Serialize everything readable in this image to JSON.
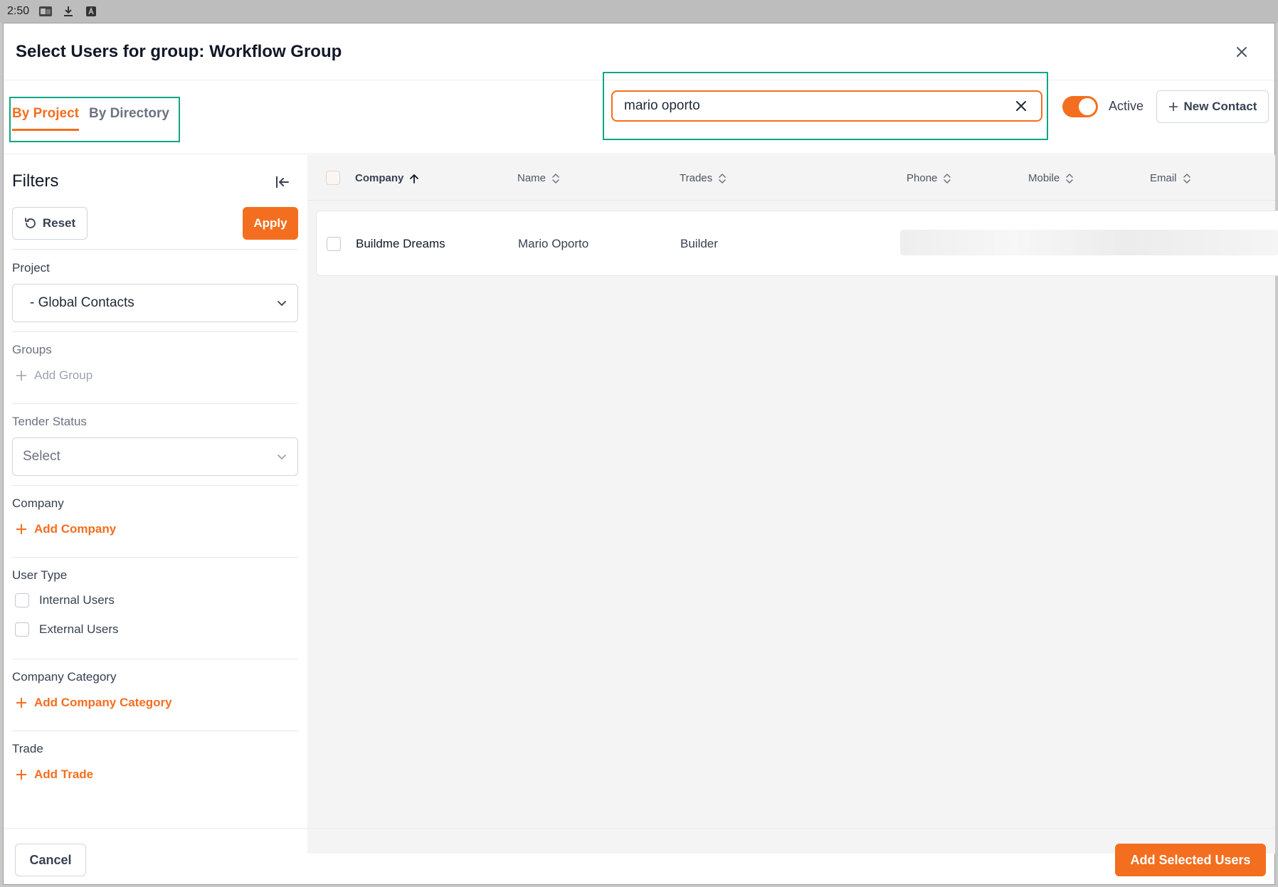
{
  "statusbar": {
    "time": "2:50",
    "icons": [
      "outlook-icon",
      "download-icon",
      "app-a-icon"
    ]
  },
  "modal": {
    "title": "Select Users for group: Workflow Group"
  },
  "tabs": [
    {
      "label": "By Project",
      "active": true
    },
    {
      "label": "By Directory",
      "active": false
    }
  ],
  "search": {
    "value": "mario oporto",
    "placeholder": ""
  },
  "toolbar": {
    "active_label": "Active",
    "active_on": true,
    "new_contact_label": "New Contact"
  },
  "filters": {
    "title": "Filters",
    "reset_label": "Reset",
    "apply_label": "Apply",
    "project": {
      "label": "Project",
      "value": "- Global Contacts"
    },
    "groups": {
      "label": "Groups",
      "add_label": "Add Group"
    },
    "tender_status": {
      "label": "Tender Status",
      "placeholder": "Select"
    },
    "company": {
      "label": "Company",
      "add_label": "Add Company"
    },
    "user_type": {
      "label": "User Type",
      "options": [
        "Internal Users",
        "External Users"
      ]
    },
    "company_category": {
      "label": "Company Category",
      "add_label": "Add Company Category"
    },
    "trade": {
      "label": "Trade",
      "add_label": "Add Trade"
    }
  },
  "table": {
    "columns": [
      "Company",
      "Name",
      "Trades",
      "Phone",
      "Mobile",
      "Email"
    ],
    "rows": [
      {
        "company": "Buildme Dreams",
        "name": "Mario Oporto",
        "trades": "Builder"
      }
    ]
  },
  "footer": {
    "cancel_label": "Cancel",
    "add_selected_label": "Add Selected Users"
  },
  "colors": {
    "accent": "#f46e1f",
    "highlight": "#13a487"
  }
}
